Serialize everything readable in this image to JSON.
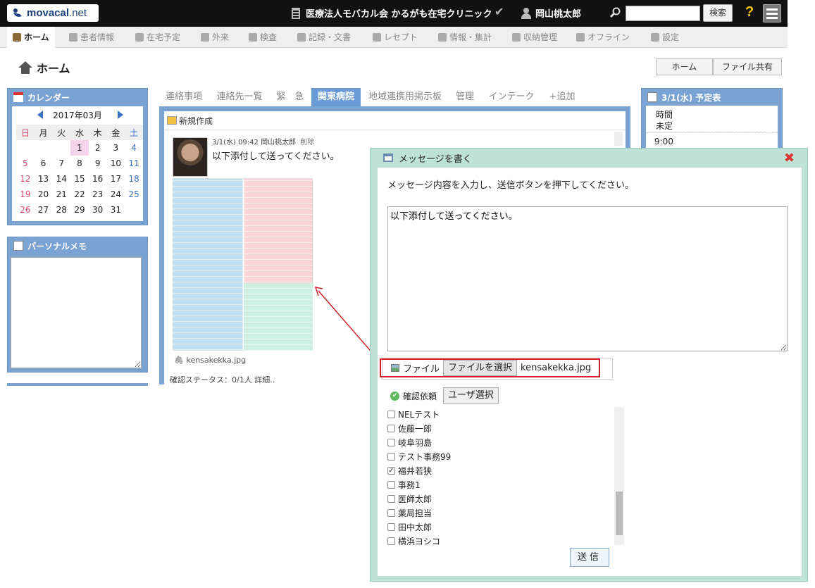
{
  "topbar": {
    "logo_text": "movacal",
    "logo_suffix": ".net",
    "clinic_name": "医療法人モバカル会 かるがも在宅クリニック",
    "user_name": "岡山桃太郎",
    "search_placeholder": "",
    "search_button": "検索",
    "help_label": "?"
  },
  "nav": {
    "items": [
      "ホーム",
      "患者情報",
      "在宅予定",
      "外来",
      "検査",
      "記録・文書",
      "レセプト",
      "情報・集計",
      "収納管理",
      "オフライン",
      "設定"
    ]
  },
  "page": {
    "title": "ホーム",
    "buttons": [
      "ホーム",
      "ファイル共有"
    ]
  },
  "calendar": {
    "title": "カレンダー",
    "month": "2017年03月",
    "weekdays": [
      "日",
      "月",
      "火",
      "水",
      "木",
      "金",
      "土"
    ],
    "weeks": [
      [
        "",
        "",
        "",
        "1",
        "2",
        "3",
        "4"
      ],
      [
        "5",
        "6",
        "7",
        "8",
        "9",
        "10",
        "11"
      ],
      [
        "12",
        "13",
        "14",
        "15",
        "16",
        "17",
        "18"
      ],
      [
        "19",
        "20",
        "21",
        "22",
        "23",
        "24",
        "25"
      ],
      [
        "26",
        "27",
        "28",
        "29",
        "30",
        "31",
        ""
      ]
    ],
    "today": "1"
  },
  "memo": {
    "title": "パーソナルメモ",
    "value": ""
  },
  "center": {
    "tabs": [
      "連絡事項",
      "連絡先一覧",
      "緊　急",
      "関東病院",
      "地域連携用掲示板",
      "管理",
      "インテーク",
      "+追加"
    ],
    "active_tab": "関東病院",
    "new_button": "新規作成",
    "post": {
      "meta": "3/1(水) 09:42 岡山桃太郎",
      "delete": "削除",
      "text": "以下添付して送ってください。",
      "attachment": "kensakekka.jpg",
      "status": "確認ステータス：0/1人 詳細.."
    }
  },
  "schedule": {
    "title": "3/1(水) 予定表",
    "rows": [
      "時間",
      "未定",
      "9:00"
    ]
  },
  "dialog": {
    "title": "メッセージを書く",
    "instruction": "メッセージ内容を入力し、送信ボタンを押下してください。",
    "message": "以下添付して送ってください。",
    "file_label": "ファイル",
    "choose_button": "ファイルを選択",
    "file_name": "kensakekka.jpg",
    "confirm_label": "確認依頼",
    "user_select_button": "ユーザ選択",
    "users": [
      {
        "name": "NELテスト",
        "checked": false
      },
      {
        "name": "佐藤一郎",
        "checked": false
      },
      {
        "name": "岐阜羽島",
        "checked": false
      },
      {
        "name": "テスト事務99",
        "checked": false
      },
      {
        "name": "福井若狭",
        "checked": true
      },
      {
        "name": "事務1",
        "checked": false
      },
      {
        "name": "医師太郎",
        "checked": false
      },
      {
        "name": "薬局担当",
        "checked": false
      },
      {
        "name": "田中太郎",
        "checked": false
      },
      {
        "name": "横浜ヨシコ",
        "checked": false
      }
    ],
    "send_button": "送信"
  },
  "colors": {
    "accent": "#7aa3d4",
    "dialog_bg": "#bfe2d6",
    "highlight": "#d3232a",
    "sunday": "#e0446a",
    "saturday": "#3b73c4",
    "today_bg": "#f5d4ec"
  }
}
